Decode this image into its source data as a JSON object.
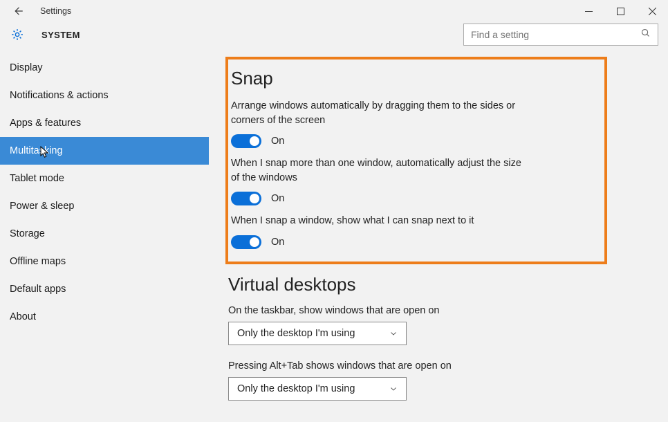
{
  "window": {
    "title": "Settings"
  },
  "breadcrumb": "SYSTEM",
  "search": {
    "placeholder": "Find a setting"
  },
  "sidebar": {
    "items": [
      {
        "label": "Display"
      },
      {
        "label": "Notifications & actions"
      },
      {
        "label": "Apps & features"
      },
      {
        "label": "Multitasking",
        "selected": true
      },
      {
        "label": "Tablet mode"
      },
      {
        "label": "Power & sleep"
      },
      {
        "label": "Storage"
      },
      {
        "label": "Offline maps"
      },
      {
        "label": "Default apps"
      },
      {
        "label": "About"
      }
    ]
  },
  "snap": {
    "heading": "Snap",
    "settings": [
      {
        "desc": "Arrange windows automatically by dragging them to the sides or corners of the screen",
        "state": "On"
      },
      {
        "desc": "When I snap more than one window, automatically adjust the size of the windows",
        "state": "On"
      },
      {
        "desc": "When I snap a window, show what I can snap next to it",
        "state": "On"
      }
    ]
  },
  "virtual_desktops": {
    "heading": "Virtual desktops",
    "taskbar": {
      "desc": "On the taskbar, show windows that are open on",
      "value": "Only the desktop I'm using"
    },
    "alttab": {
      "desc": "Pressing Alt+Tab shows windows that are open on",
      "value": "Only the desktop I'm using"
    }
  },
  "colors": {
    "accent": "#0a6fd8",
    "highlight_border": "#ed7d1a"
  }
}
